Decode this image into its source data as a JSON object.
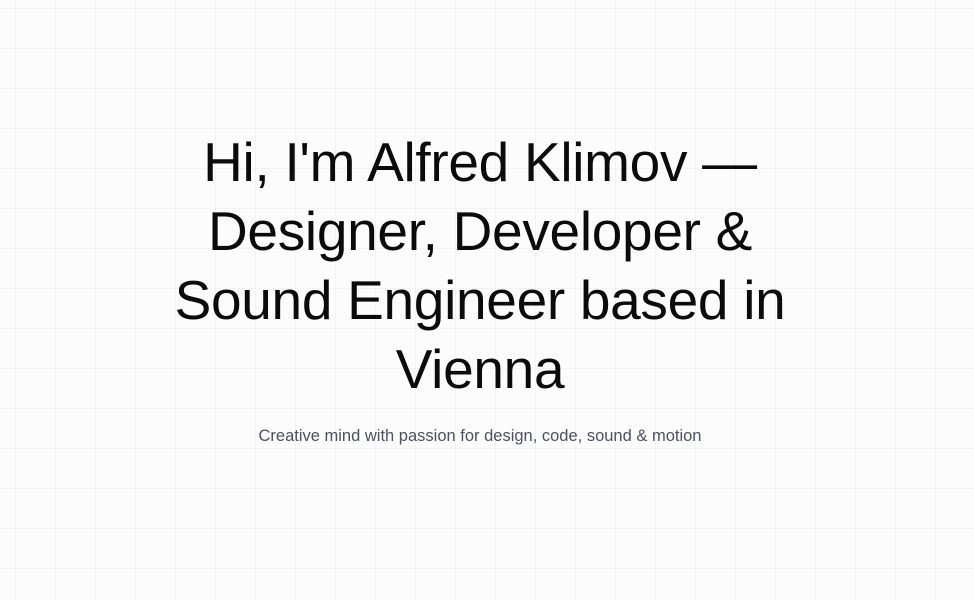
{
  "hero": {
    "title": "Hi, I'm Alfred Klimov — Designer, Developer & Sound Engineer based in Vienna",
    "subtitle": "Creative mind with passion for design, code, sound & motion"
  }
}
